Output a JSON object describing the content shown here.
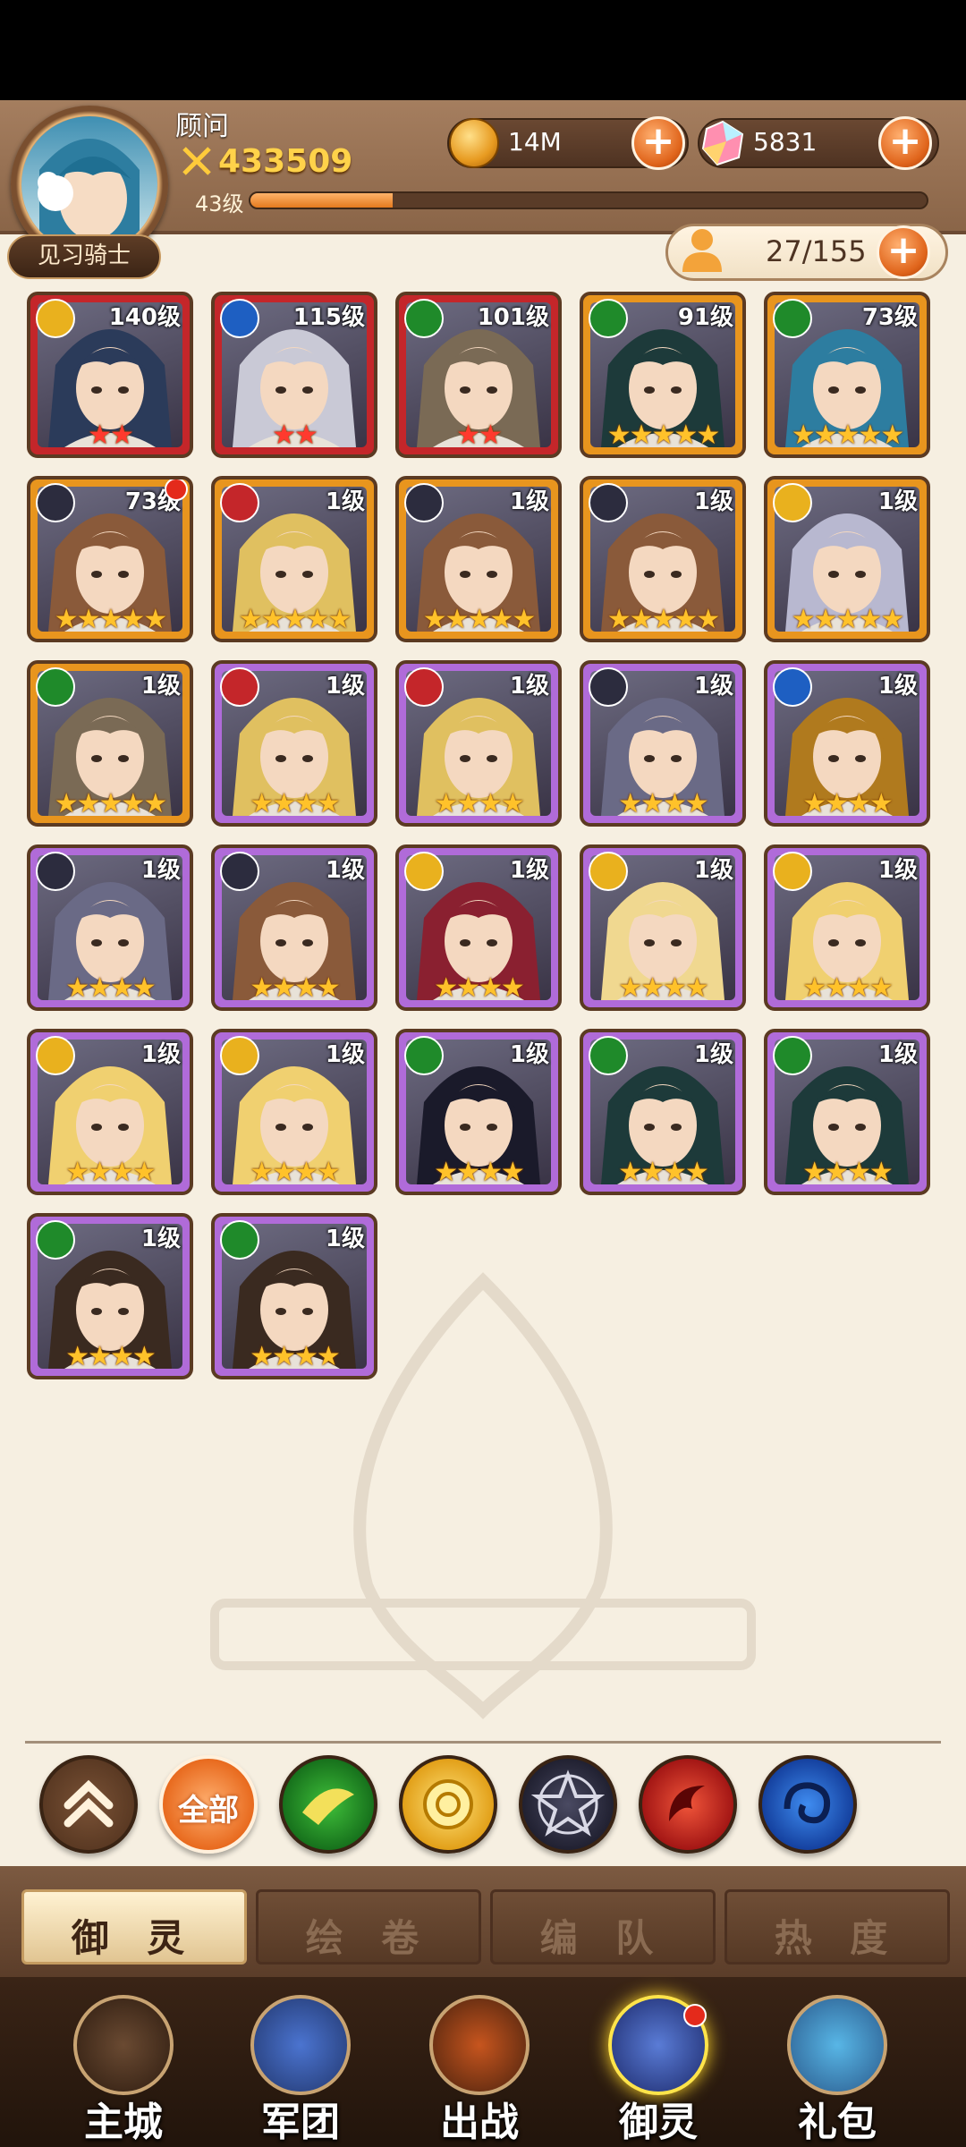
{
  "player": {
    "name": "顾问",
    "power": "433509",
    "level": "43级",
    "xp_fraction": 0.21,
    "rank": "见习骑士"
  },
  "resources": {
    "gold": "14M",
    "gems": "5831",
    "roster": "27/155"
  },
  "cards": [
    {
      "level": "140级",
      "stars": "★★",
      "faction": "light",
      "frame": "red"
    },
    {
      "level": "115级",
      "stars": "★★",
      "faction": "water",
      "frame": "red"
    },
    {
      "level": "101级",
      "stars": "★★",
      "faction": "nature",
      "frame": "red"
    },
    {
      "level": "91级",
      "stars": "★★★★★",
      "faction": "nature",
      "frame": "gold"
    },
    {
      "level": "73级",
      "stars": "★★★★★",
      "faction": "nature",
      "frame": "gold"
    },
    {
      "level": "73级",
      "stars": "★★★★★",
      "faction": "dark",
      "frame": "gold"
    },
    {
      "level": "1级",
      "stars": "★★★★★",
      "faction": "fire",
      "frame": "gold"
    },
    {
      "level": "1级",
      "stars": "★★★★★",
      "faction": "dark",
      "frame": "gold"
    },
    {
      "level": "1级",
      "stars": "★★★★★",
      "faction": "dark",
      "frame": "gold"
    },
    {
      "level": "1级",
      "stars": "★★★★★",
      "faction": "light",
      "frame": "gold"
    },
    {
      "level": "1级",
      "stars": "★★★★★",
      "faction": "nature",
      "frame": "gold"
    },
    {
      "level": "1级",
      "stars": "★★★★",
      "faction": "fire",
      "frame": "purple"
    },
    {
      "level": "1级",
      "stars": "★★★★",
      "faction": "fire",
      "frame": "purple"
    },
    {
      "level": "1级",
      "stars": "★★★★",
      "faction": "dark",
      "frame": "purple"
    },
    {
      "level": "1级",
      "stars": "★★★★",
      "faction": "water",
      "frame": "purple"
    },
    {
      "level": "1级",
      "stars": "★★★★",
      "faction": "dark",
      "frame": "purple"
    },
    {
      "level": "1级",
      "stars": "★★★★",
      "faction": "dark",
      "frame": "purple"
    },
    {
      "level": "1级",
      "stars": "★★★★",
      "faction": "light",
      "frame": "purple"
    },
    {
      "level": "1级",
      "stars": "★★★★",
      "faction": "light",
      "frame": "purple"
    },
    {
      "level": "1级",
      "stars": "★★★★",
      "faction": "light",
      "frame": "purple"
    },
    {
      "level": "1级",
      "stars": "★★★★",
      "faction": "light",
      "frame": "purple"
    },
    {
      "level": "1级",
      "stars": "★★★★",
      "faction": "light",
      "frame": "purple"
    },
    {
      "level": "1级",
      "stars": "★★★★",
      "faction": "nature",
      "frame": "purple"
    },
    {
      "level": "1级",
      "stars": "★★★★",
      "faction": "nature",
      "frame": "purple"
    },
    {
      "level": "1级",
      "stars": "★★★★",
      "faction": "nature",
      "frame": "purple"
    },
    {
      "level": "1级",
      "stars": "★★★★",
      "faction": "nature",
      "frame": "purple"
    },
    {
      "level": "1级",
      "stars": "★★★★",
      "faction": "nature",
      "frame": "purple"
    }
  ],
  "filters": {
    "all_label": "全部"
  },
  "tabs": [
    "御 灵",
    "绘 卷",
    "编 队",
    "热 度"
  ],
  "nav": [
    "主城",
    "军团",
    "出战",
    "御灵",
    "礼包"
  ],
  "colors": {
    "nature": "#1f8a2a",
    "water": "#1e5fc2",
    "fire": "#c4262a",
    "light": "#e9b11e",
    "dark": "#2c2c3e"
  }
}
